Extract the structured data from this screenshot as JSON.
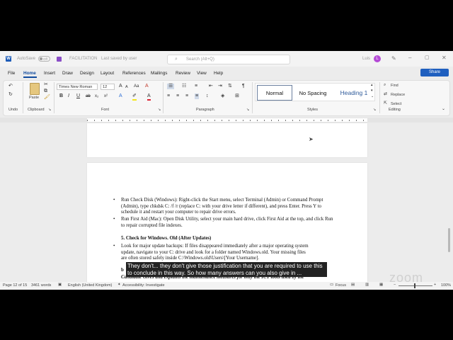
{
  "titlebar": {
    "autosave_label": "AutoSave",
    "toggle_state": "Off",
    "doc_name": "FACILITATION",
    "saved_status": "Last saved by user",
    "search_placeholder": "Search (Alt+Q)",
    "user_name": "Luis",
    "avatar_initial": "L"
  },
  "menu": {
    "items": [
      "File",
      "Home",
      "Insert",
      "Draw",
      "Design",
      "Layout",
      "References",
      "Mailings",
      "Review",
      "View",
      "Help"
    ],
    "active": "Home",
    "share_label": "Share"
  },
  "ribbon": {
    "clipboard": {
      "paste_label": "Paste",
      "group_label": "Clipboard"
    },
    "undo": {
      "group_label": "Undo"
    },
    "font": {
      "font_name": "Times New Roman",
      "font_size": "12",
      "group_label": "Font",
      "bold": "B",
      "italic": "I",
      "underline": "U",
      "aa_large": "A",
      "aa_small": "A"
    },
    "paragraph": {
      "group_label": "Paragraph"
    },
    "styles": {
      "group_label": "Styles",
      "items": [
        "Normal",
        "No Spacing",
        "Heading 1"
      ],
      "selected": "Normal"
    },
    "editing": {
      "group_label": "Editing",
      "find_label": "Find",
      "replace_label": "Replace",
      "select_label": "Select"
    }
  },
  "document": {
    "bullets": [
      "Run Check Disk (Windows): Right-click the Start menu, select Terminal (Admin) or Command Prompt (Admin), type chkdsk C: /f /r (replace C: with your drive letter if different), and press Enter. Press Y to schedule it and restart your computer to repair drive errors.",
      "Run First Aid (Mac): Open Disk Utility, select your main hard drive, click First Aid at the top, and click Run to repair corrupted file indexes."
    ],
    "heading": "5. Check for Windows. Old (After Updates)",
    "bullet3_line1": "Look for major update backups: If files disappeared immediately after a major operating system",
    "bullet3_line2": "update, navigate to your C: drive and look for a folder named Windows.old. Your missing files",
    "bullet3_line3": "are often stored safely inside C:\\Windows.old\\Users\\[Your Username].",
    "partial_line": "b",
    "italic_line": "Candidate Gives and explains the maintenance measures for only the ICT tools used by the"
  },
  "status": {
    "page": "Page 12 of 15",
    "words": "3461 words",
    "language": "English (United Kingdom)",
    "accessibility": "Accessibility: Investigate",
    "focus": "Focus",
    "zoom": "100%"
  },
  "overlay": {
    "caption": "They don't... they don't give those justification that you are required to use this to conclude in this way. So how many answers can you also give in ...",
    "watermark": "zoom"
  }
}
